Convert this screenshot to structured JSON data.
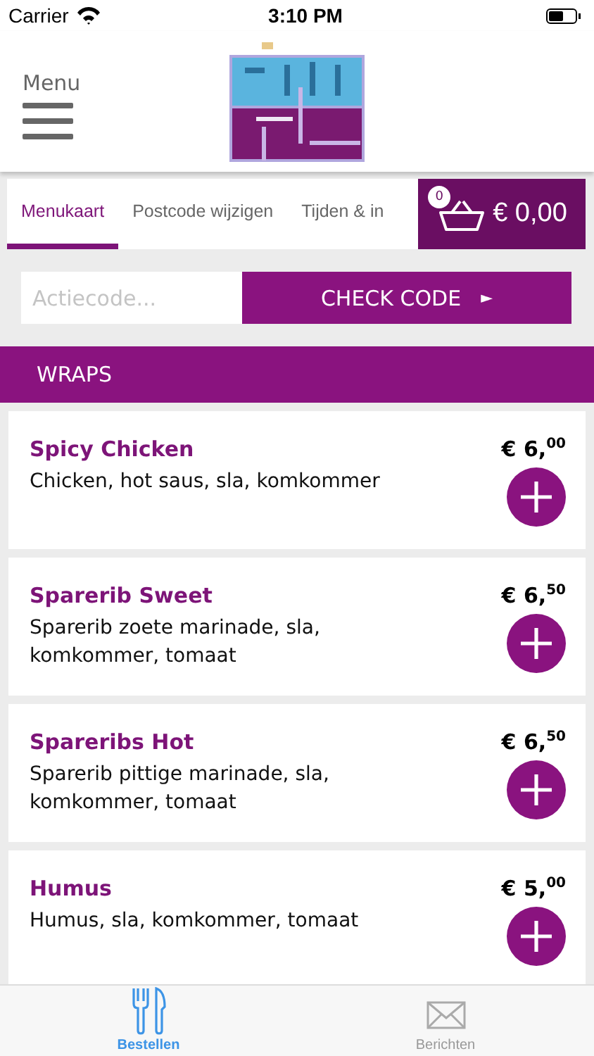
{
  "status_bar": {
    "carrier": "Carrier",
    "time": "3:10 PM"
  },
  "header": {
    "menu_label": "Menu"
  },
  "tabs": [
    {
      "label": "Menukaart",
      "selected": true
    },
    {
      "label": "Postcode wijzigen",
      "selected": false
    },
    {
      "label": "Tijden & in",
      "selected": false
    }
  ],
  "cart": {
    "count": "0",
    "total": "€ 0,00"
  },
  "promo": {
    "placeholder": "Actiecode...",
    "button": "CHECK CODE",
    "button_icon": "►"
  },
  "category": "WRAPS",
  "items": [
    {
      "name": "Spicy Chicken",
      "description": "Chicken, hot saus, sla, komkommer",
      "price": "€ 6,$^{00}$"
    },
    {
      "name": "Sparerib Sweet",
      "description": "Sparerib zoete marinade, sla, komkommer, tomaat",
      "price": "€ 6,$^{50}$"
    },
    {
      "name": "Spareribs Hot",
      "description": "Sparerib pittige marinade, sla, komkommer, tomaat",
      "price": "€ 6,$^{50}$"
    },
    {
      "name": "Humus",
      "description": "Humus, sla, komkommer, tomaat",
      "price": "€ 5,$^{00}$"
    }
  ],
  "bottom_tabs": [
    {
      "label": "Bestellen",
      "selected": true
    },
    {
      "label": "Berichten",
      "selected": false
    }
  ]
}
